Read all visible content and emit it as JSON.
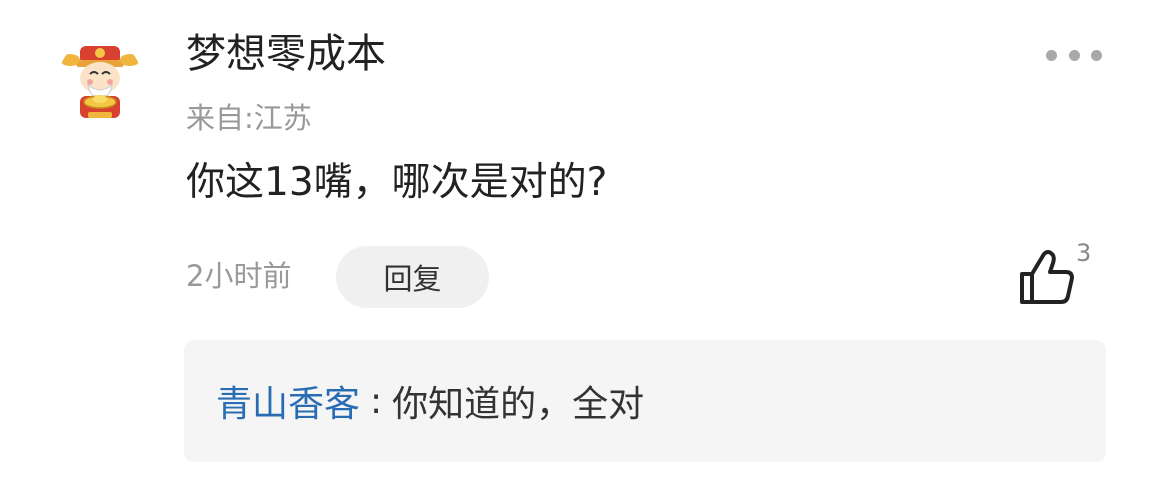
{
  "comment": {
    "avatar_icon": "god-of-wealth-avatar-icon",
    "username": "梦想零成本",
    "location": "来自:江苏",
    "text": "你这13嘴，哪次是对的?",
    "time": "2小时前",
    "reply_label": "回复",
    "like_icon": "thumbs-up-icon",
    "like_count": "3",
    "more_icon": "more-dots-icon"
  },
  "reply": {
    "author": "青山香客",
    "separator": ":",
    "text": "你知道的，全对"
  },
  "colors": {
    "username": "#222222",
    "secondary_text": "#999999",
    "reply_author": "#2a6cb3",
    "reply_background": "#f5f5f5",
    "reply_button_background": "#f0f0f0"
  }
}
